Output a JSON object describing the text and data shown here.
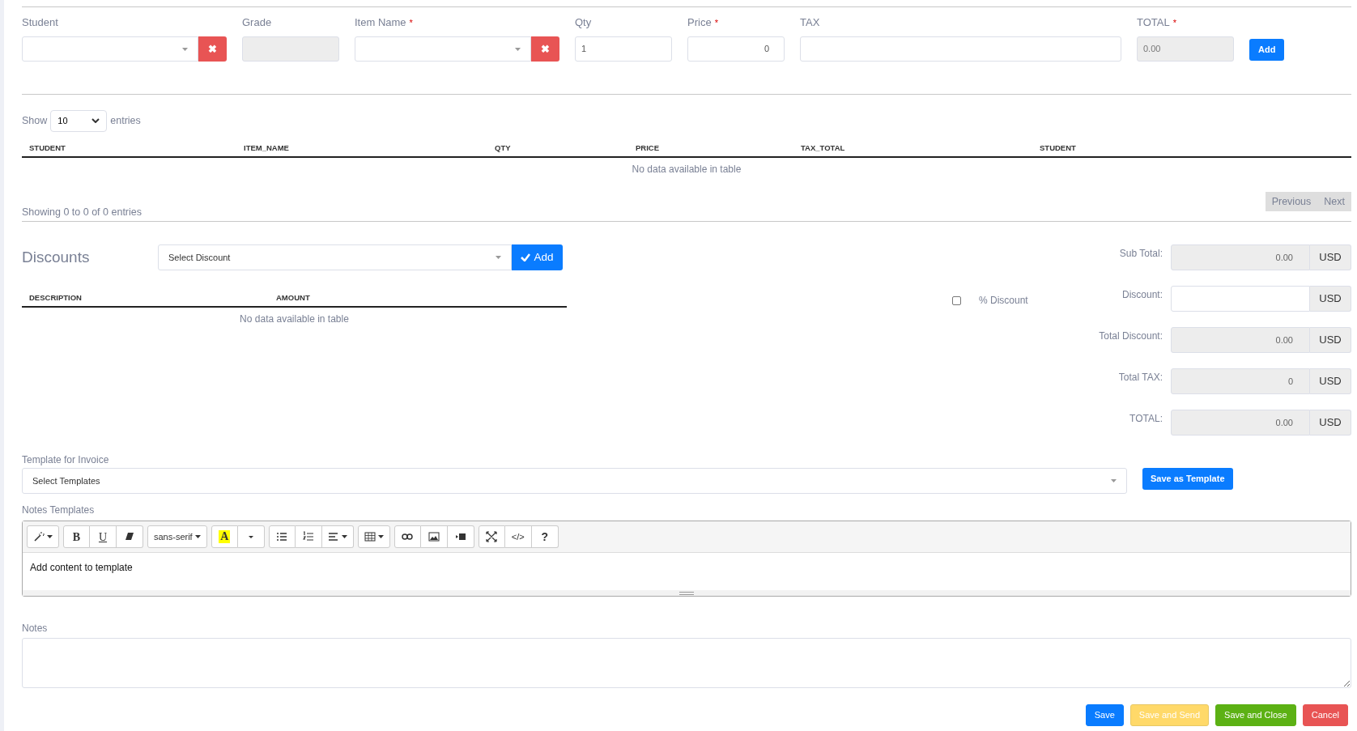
{
  "item_form": {
    "fields": [
      {
        "kind": "select",
        "label": "Student",
        "clear_icon": "✖"
      },
      {
        "kind": "readonly",
        "label": "Grade"
      },
      {
        "kind": "select",
        "label": "Item Name",
        "required_mark": "*",
        "clear_icon": "✖"
      },
      {
        "kind": "input",
        "label": "Qty",
        "value": "1"
      },
      {
        "kind": "number",
        "label": "Price",
        "required_mark": "*",
        "value": "0"
      },
      {
        "kind": "wide",
        "label": "TAX"
      },
      {
        "kind": "readonly",
        "label": "TOTAL",
        "required_mark": "*",
        "value": "0.00"
      }
    ],
    "add_button": "Add"
  },
  "items_table": {
    "show_label": "Show",
    "page_size": "10",
    "entries_label": "entries",
    "columns": [
      "STUDENT",
      "ITEM_NAME",
      "QTY",
      "PRICE",
      "TAX_TOTAL",
      "STUDENT"
    ],
    "empty_text": "No data available in table",
    "info": "Showing 0 to 0 of 0 entries",
    "pagination": [
      {
        "label": "Previous",
        "disabled": true
      },
      {
        "label": "Next",
        "disabled": true
      }
    ]
  },
  "discounts": {
    "title": "Discounts",
    "select_placeholder": "Select Discount",
    "add_button": "Add",
    "columns": [
      "DESCRIPTION",
      "AMOUNT"
    ],
    "empty_text": "No data available in table"
  },
  "summary": [
    {
      "label": "Sub Total:",
      "value": "0.00",
      "currency": "USD",
      "readonly": true
    },
    {
      "label": "Discount:",
      "currency": "USD",
      "readonly": false,
      "toggle": {
        "label": "% Discount",
        "checked": false
      }
    },
    {
      "label": "Total Discount:",
      "value": "0.00",
      "currency": "USD",
      "readonly": true
    },
    {
      "label": "Total TAX:",
      "value": "0",
      "currency": "USD",
      "readonly": true
    },
    {
      "label": "TOTAL:",
      "value": "0.00",
      "currency": "USD",
      "readonly": true
    }
  ],
  "template": {
    "label": "Template for Invoice",
    "select_placeholder": "Select Templates",
    "save_button": "Save as Template"
  },
  "notes_templates": {
    "label": "Notes Templates",
    "toolbar": [
      [
        {
          "kind": "wand",
          "dropdown": true
        }
      ],
      [
        {
          "kind": "bold",
          "label": "B"
        },
        {
          "kind": "underline",
          "label": "U"
        },
        {
          "kind": "eraser"
        }
      ],
      [
        {
          "kind": "text",
          "label": "sans-serif",
          "dropdown": true
        }
      ],
      [
        {
          "kind": "highlight",
          "label": "A"
        },
        {
          "kind": "caret"
        }
      ],
      [
        {
          "kind": "bullets"
        },
        {
          "kind": "numbers"
        },
        {
          "kind": "align",
          "dropdown": true
        }
      ],
      [
        {
          "kind": "table",
          "dropdown": true
        }
      ],
      [
        {
          "kind": "link"
        },
        {
          "kind": "picture"
        },
        {
          "kind": "video"
        }
      ],
      [
        {
          "kind": "fullscreen"
        },
        {
          "kind": "text",
          "label": "</>"
        },
        {
          "kind": "strong",
          "label": "?"
        }
      ]
    ],
    "content": "Add content to template"
  },
  "notes": {
    "label": "Notes"
  },
  "actions": [
    {
      "kind": "primary",
      "label": "Save",
      "disabled": false
    },
    {
      "kind": "warning",
      "label": "Save and Send",
      "disabled": true
    },
    {
      "kind": "success",
      "label": "Save and Close",
      "disabled": false
    },
    {
      "kind": "danger",
      "label": "Cancel",
      "disabled": false
    }
  ]
}
